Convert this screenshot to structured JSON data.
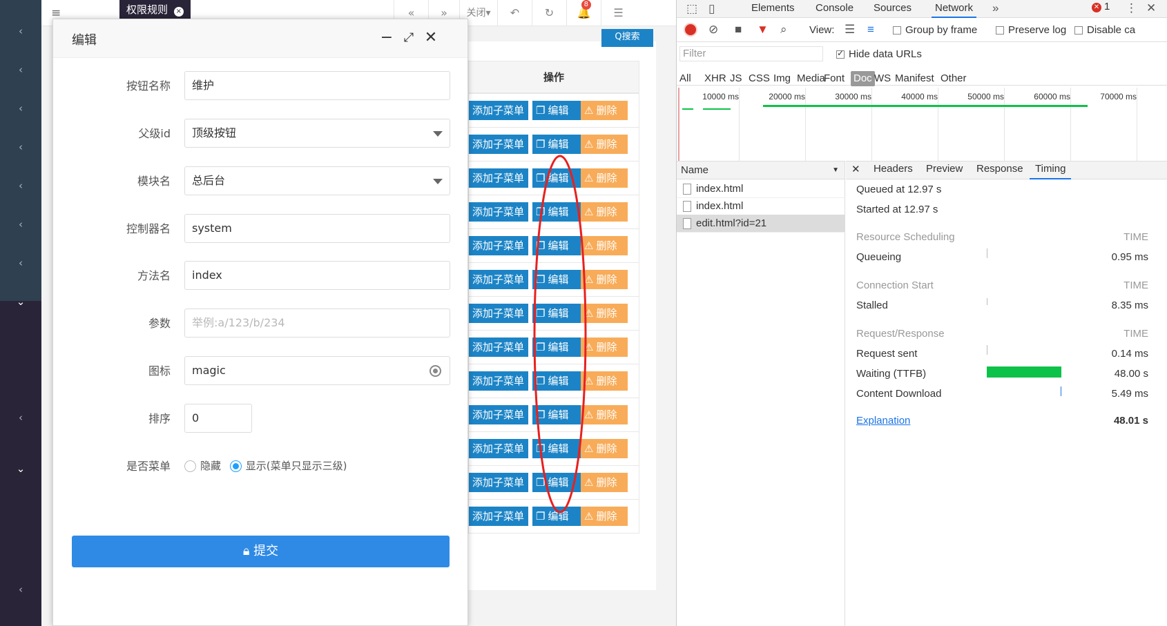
{
  "tabs": {
    "current": "权限规则",
    "close_glyph": "×"
  },
  "toolbar": {
    "close_label": "关闭",
    "notification_count": "8"
  },
  "search_button": "Q搜索",
  "table": {
    "header": "操作",
    "rows": [
      {
        "add": "添加子菜单",
        "edit": "编辑",
        "del": "删除"
      },
      {
        "add": "添加子菜单",
        "edit": "编辑",
        "del": "删除"
      },
      {
        "add": "添加子菜单",
        "edit": "编辑",
        "del": "删除"
      },
      {
        "add": "添加子菜单",
        "edit": "编辑",
        "del": "删除"
      },
      {
        "add": "添加子菜单",
        "edit": "编辑",
        "del": "删除"
      },
      {
        "add": "添加子菜单",
        "edit": "编辑",
        "del": "删除"
      },
      {
        "add": "添加子菜单",
        "edit": "编辑",
        "del": "删除"
      },
      {
        "add": "添加子菜单",
        "edit": "编辑",
        "del": "删除"
      },
      {
        "add": "添加子菜单",
        "edit": "编辑",
        "del": "删除"
      },
      {
        "add": "添加子菜单",
        "edit": "编辑",
        "del": "删除"
      },
      {
        "add": "添加子菜单",
        "edit": "编辑",
        "del": "删除"
      },
      {
        "add": "添加子菜单",
        "edit": "编辑",
        "del": "删除"
      },
      {
        "add": "添加子菜单",
        "edit": "编辑",
        "del": "删除"
      }
    ]
  },
  "modal": {
    "title": "编辑",
    "fields": {
      "button_name": {
        "label": "按钮名称",
        "value": "维护"
      },
      "parent_id": {
        "label": "父级id",
        "value": "顶级按钮"
      },
      "module": {
        "label": "模块名",
        "value": "总后台"
      },
      "controller": {
        "label": "控制器名",
        "value": "system"
      },
      "method": {
        "label": "方法名",
        "value": "index"
      },
      "params": {
        "label": "参数",
        "placeholder": "举例:a/123/b/234"
      },
      "icon": {
        "label": "图标",
        "value": "magic"
      },
      "sort": {
        "label": "排序",
        "value": "0"
      },
      "is_menu": {
        "label": "是否菜单",
        "opt_hide": "隐藏",
        "opt_show": "显示(菜单只显示三级)",
        "selected": "show"
      }
    },
    "submit_label": "提交"
  },
  "devtools": {
    "tabs": [
      "Elements",
      "Console",
      "Sources",
      "Network"
    ],
    "active_tab": "Network",
    "error_count": "1",
    "toolbar": {
      "view_label": "View:",
      "group_by_frame": "Group by frame",
      "preserve_log": "Preserve log",
      "disable_cache": "Disable ca"
    },
    "filter_placeholder": "Filter",
    "hide_data_urls": "Hide data URLs",
    "type_filters": [
      "All",
      "XHR",
      "JS",
      "CSS",
      "Img",
      "Media",
      "Font",
      "Doc",
      "WS",
      "Manifest",
      "Other"
    ],
    "selected_filter": "Doc",
    "timeline_ticks": [
      "10000 ms",
      "20000 ms",
      "30000 ms",
      "40000 ms",
      "50000 ms",
      "60000 ms",
      "70000 ms"
    ],
    "name_header": "Name",
    "requests": [
      "index.html",
      "index.html",
      "edit.html?id=21"
    ],
    "selected_request": "edit.html?id=21",
    "detail_tabs": [
      "Headers",
      "Preview",
      "Response",
      "Timing"
    ],
    "active_detail_tab": "Timing",
    "timing": {
      "queued_at": "Queued at 12.97 s",
      "started_at": "Started at 12.97 s",
      "sections": [
        {
          "title": "Resource Scheduling",
          "col": "TIME",
          "rows": [
            {
              "label": "Queueing",
              "value": "0.95 ms"
            }
          ]
        },
        {
          "title": "Connection Start",
          "col": "TIME",
          "rows": [
            {
              "label": "Stalled",
              "value": "8.35 ms"
            }
          ]
        },
        {
          "title": "Request/Response",
          "col": "TIME",
          "rows": [
            {
              "label": "Request sent",
              "value": "0.14 ms"
            },
            {
              "label": "Waiting (TTFB)",
              "value": "48.00 s"
            },
            {
              "label": "Content Download",
              "value": "5.49 ms"
            }
          ]
        }
      ],
      "explanation_link": "Explanation",
      "total": "48.01 s"
    },
    "colors": {
      "accent": "#1a73e8",
      "waiting_bar": "#0cc249",
      "record": "#d93025"
    }
  },
  "colors": {
    "primary_blue": "#1c84c6",
    "warning_orange": "#f8ac59",
    "submit_blue": "#2f8ae5",
    "annotation_red": "#e8201f"
  }
}
